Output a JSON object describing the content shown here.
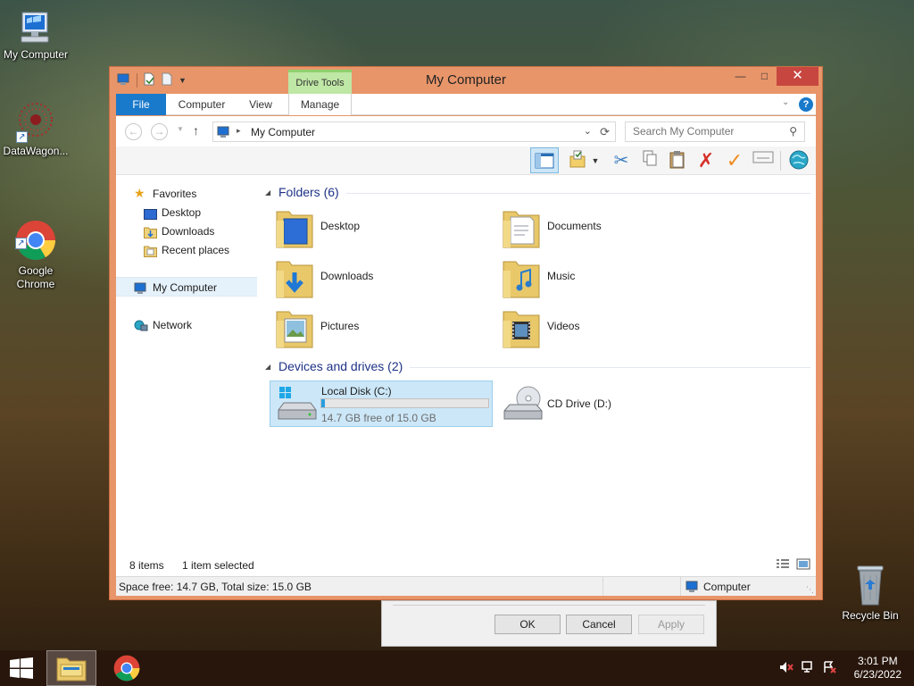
{
  "desktop": {
    "icons": [
      {
        "label": "My Computer"
      },
      {
        "label": "DataWagon..."
      },
      {
        "label": "Google\nChrome"
      },
      {
        "label": "Recycle Bin"
      }
    ]
  },
  "window": {
    "title": "My Computer",
    "contextual_tab_group": "Drive Tools",
    "tabs": [
      "File",
      "Computer",
      "View",
      "Manage"
    ],
    "address": "My Computer",
    "search_placeholder": "Search My Computer",
    "nav_pane": {
      "favorites": "Favorites",
      "favorites_items": [
        "Desktop",
        "Downloads",
        "Recent places"
      ],
      "my_computer": "My Computer",
      "network": "Network"
    },
    "groups": {
      "folders_title": "Folders (6)",
      "folders": [
        "Desktop",
        "Documents",
        "Downloads",
        "Music",
        "Pictures",
        "Videos"
      ],
      "devices_title": "Devices and drives (2)",
      "drives": [
        {
          "name": "Local Disk (C:)",
          "free_text": "14.7 GB free of 15.0 GB",
          "used_fraction": 0.02
        },
        {
          "name": "CD Drive (D:)"
        }
      ]
    },
    "status": {
      "items": "8 items",
      "selected": "1 item selected",
      "space": "Space free: 14.7 GB, Total size: 15.0 GB",
      "location": "Computer"
    }
  },
  "dialog": {
    "ok": "OK",
    "cancel": "Cancel",
    "apply": "Apply"
  },
  "taskbar": {
    "time": "3:01 PM",
    "date": "6/23/2022"
  },
  "colors": {
    "window_frame": "#e8956a",
    "file_tab": "#1979ca",
    "drive_tools": "#bfe7a5",
    "selection": "#cce7f8",
    "group_title": "#1e3287"
  }
}
